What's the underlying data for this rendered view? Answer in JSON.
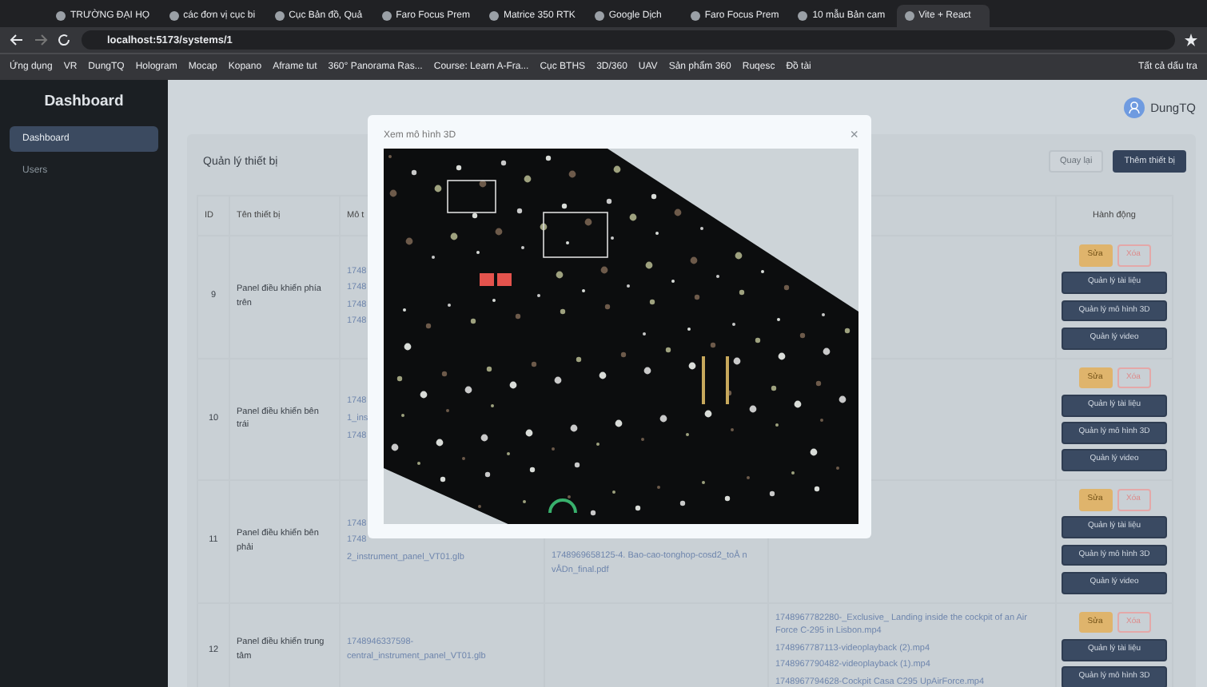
{
  "browser": {
    "tabs": [
      {
        "title": "TRƯỜNG ĐẠI HỌ",
        "selected": false
      },
      {
        "title": "các đơn vị cục bi",
        "selected": false
      },
      {
        "title": "Cục Bản đồ, Quả",
        "selected": false
      },
      {
        "title": "Faro Focus Prem",
        "selected": false
      },
      {
        "title": "Matrice 350 RTK",
        "selected": false
      },
      {
        "title": "Google Dịch",
        "selected": false
      },
      {
        "title": "Faro Focus Prem",
        "selected": false
      },
      {
        "title": "10 mẫu Bản cam",
        "selected": false
      },
      {
        "title": "Vite + React",
        "selected": true
      }
    ],
    "address": "localhost:5173/systems/1",
    "bookmarks": [
      "Ứng dụng",
      "VR",
      "DungTQ",
      "Hologram",
      "Mocap",
      "Kopano",
      "Aframe tut",
      "360° Panorama Ras...",
      "Course: Learn A-Fra...",
      "Cục BTHS",
      "3D/360",
      "UAV",
      "Sản phẩm 360",
      "Ruqesc",
      "Đồ tài"
    ],
    "bookmarks_all": "Tất cả dấu tra"
  },
  "sidebar": {
    "title": "Dashboard",
    "items": [
      {
        "label": "Dashboard",
        "selected": true
      },
      {
        "label": "Users",
        "selected": false
      }
    ]
  },
  "header": {
    "user": "DungTQ"
  },
  "card": {
    "title": "Quản lý thiết bị",
    "buttons": [
      {
        "label": "Quay lại",
        "kind": "secondary"
      },
      {
        "label": "Thêm thiết bị",
        "kind": "primary"
      }
    ]
  },
  "table": {
    "columns": [
      {
        "label": "ID"
      },
      {
        "label": "Tên thiết bị"
      },
      {
        "label": "Mô t"
      },
      {},
      {},
      {
        "label": "Hành động"
      }
    ],
    "rows": [
      {
        "id": "9",
        "name": "Panel điều khiển phía trên",
        "models": [
          "1748",
          "1748",
          "1748",
          "1748"
        ],
        "documents": [],
        "videos": [],
        "actions": [
          "Sửa",
          "Xóa",
          "Quản lý tài liệu",
          "Quản lý mô hình 3D",
          "Quản lý video"
        ]
      },
      {
        "id": "10",
        "name": "Panel điều khiển bên trái",
        "models": [
          "1748",
          "1_ins",
          "1748"
        ],
        "documents": [],
        "videos": [],
        "actions": [
          "Sửa",
          "Xóa",
          "Quản lý tài liệu",
          "Quản lý mô hình 3D",
          "Quản lý video"
        ]
      },
      {
        "id": "11",
        "name": "Panel điều khiển bên phải",
        "models": [
          "1748",
          "1748",
          "2_instrument_panel_VT01.glb"
        ],
        "documents": [
          "1748969658125-4. Bao-cao-tonghop-cosd2_toÅ n vÅDn_final.pdf"
        ],
        "videos": [],
        "actions": [
          "Sửa",
          "Xóa",
          "Quản lý tài liệu",
          "Quản lý mô hình 3D",
          "Quản lý video"
        ]
      },
      {
        "id": "12",
        "name": "Panel điều khiển trung tâm",
        "models": [
          "1748946337598-central_instrument_panel_VT01.glb"
        ],
        "documents": [],
        "videos": [
          "1748967782280-_Exclusive_ Landing inside the cockpit of an Air Force C-295 in Lisbon.mp4",
          "1748967787113-videoplayback (2).mp4",
          "1748967790482-videoplayback (1).mp4",
          "1748967794628-Cockpit Casa C295 UpAirForce.mp4"
        ],
        "actions": [
          "Sửa",
          "Xóa",
          "Quản lý tài liệu",
          "Quản lý mô hình 3D"
        ]
      }
    ]
  },
  "modal": {
    "title": "Xem mô hình 3D",
    "close": "×"
  }
}
